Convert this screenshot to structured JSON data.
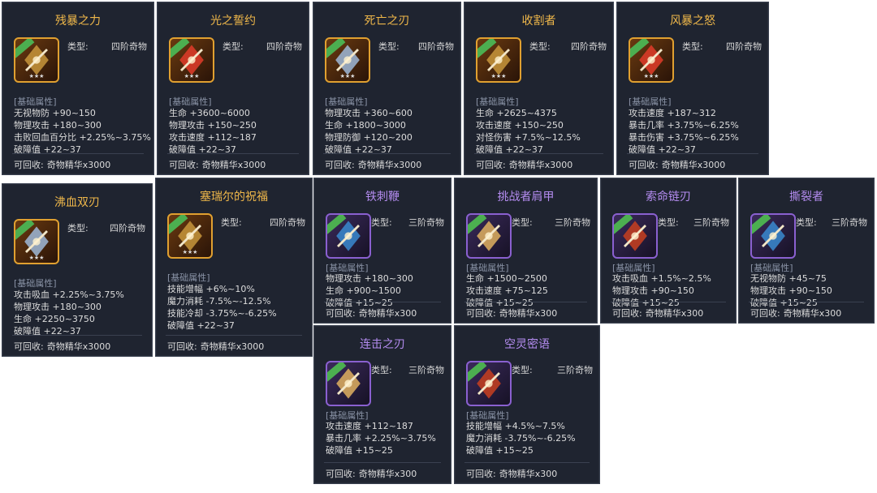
{
  "common": {
    "type_label": "类型:",
    "section_label": "[基础属性]",
    "recycle_prefix": "可回收:"
  },
  "cards": [
    {
      "name": "残暴之力",
      "type": "四阶奇物",
      "icon": "spiked-gauntlet-icon",
      "stats": [
        "无视物防 +90~150",
        "物理攻击 +180~300",
        "击败回血百分比 +2.25%~3.75%",
        "破障值 +22~37"
      ],
      "recycle": "奇物精华x3000"
    },
    {
      "name": "光之誓约",
      "type": "四阶奇物",
      "icon": "crossed-swords-icon",
      "stats": [
        "生命 +3600~6000",
        "物理攻击 +150~250",
        "攻击速度 +112~187",
        "破障值 +22~37"
      ],
      "recycle": "奇物精华x3000"
    },
    {
      "name": "死亡之刃",
      "type": "四阶奇物",
      "icon": "dagger-icon",
      "stats": [
        "物理攻击 +360~600",
        "生命 +1800~3000",
        "物理防御 +120~200",
        "破障值 +22~37"
      ],
      "recycle": "奇物精华x3000"
    },
    {
      "name": "收割者",
      "type": "四阶奇物",
      "icon": "scythe-icon",
      "stats": [
        "生命 +2625~4375",
        "攻击速度 +150~250",
        "对怪伤害 +7.5%~12.5%",
        "破障值 +22~37"
      ],
      "recycle": "奇物精华x3000"
    },
    {
      "name": "风暴之怒",
      "type": "四阶奇物",
      "icon": "trident-icon",
      "stats": [
        "攻击速度 +187~312",
        "暴击几率 +3.75%~6.25%",
        "暴击伤害 +3.75%~6.25%",
        "破障值 +22~37"
      ],
      "recycle": "奇物精华x3000"
    },
    {
      "name": "沸血双刃",
      "type": "四阶奇物",
      "icon": "twin-blades-icon",
      "stats": [
        "攻击吸血 +2.25%~3.75%",
        "物理攻击 +180~300",
        "生命 +2250~3750",
        "破障值 +22~37"
      ],
      "recycle": "奇物精华x3000"
    },
    {
      "name": "塞瑞尔的祝福",
      "type": "四阶奇物",
      "icon": "bell-icon",
      "stats": [
        "技能增幅 +6%~10%",
        "魔力消耗 -7.5%~-12.5%",
        "技能冷却 -3.75%~-6.25%",
        "破障值 +22~37"
      ],
      "recycle": "奇物精华x3000"
    },
    {
      "name": "铁刺鞭",
      "type": "三阶奇物",
      "icon": "spiked-whip-icon",
      "stats": [
        "物理攻击 +180~300",
        "生命 +900~1500",
        "破障值 +15~25"
      ],
      "recycle": "奇物精华x300"
    },
    {
      "name": "挑战者肩甲",
      "type": "三阶奇物",
      "icon": "pauldron-icon",
      "stats": [
        "生命 +1500~2500",
        "攻击速度 +75~125",
        "破障值 +15~25"
      ],
      "recycle": "奇物精华x300"
    },
    {
      "name": "索命链刃",
      "type": "三阶奇物",
      "icon": "chain-blade-icon",
      "stats": [
        "攻击吸血 +1.5%~2.5%",
        "物理攻击 +90~150",
        "破障值 +15~25"
      ],
      "recycle": "奇物精华x300"
    },
    {
      "name": "撕裂者",
      "type": "三阶奇物",
      "icon": "claw-icon",
      "stats": [
        "无视物防 +45~75",
        "物理攻击 +90~150",
        "破障值 +15~25"
      ],
      "recycle": "奇物精华x300"
    },
    {
      "name": "连击之刃",
      "type": "三阶奇物",
      "icon": "curved-blade-icon",
      "stats": [
        "攻击速度 +112~187",
        "暴击几率 +2.25%~3.75%",
        "破障值 +15~25"
      ],
      "recycle": "奇物精华x300"
    },
    {
      "name": "空灵密语",
      "type": "三阶奇物",
      "icon": "lantern-icon",
      "stats": [
        "技能增幅 +4.5%~7.5%",
        "魔力消耗 -3.75%~-6.25%",
        "破障值 +15~25"
      ],
      "recycle": "奇物精华x300"
    }
  ]
}
